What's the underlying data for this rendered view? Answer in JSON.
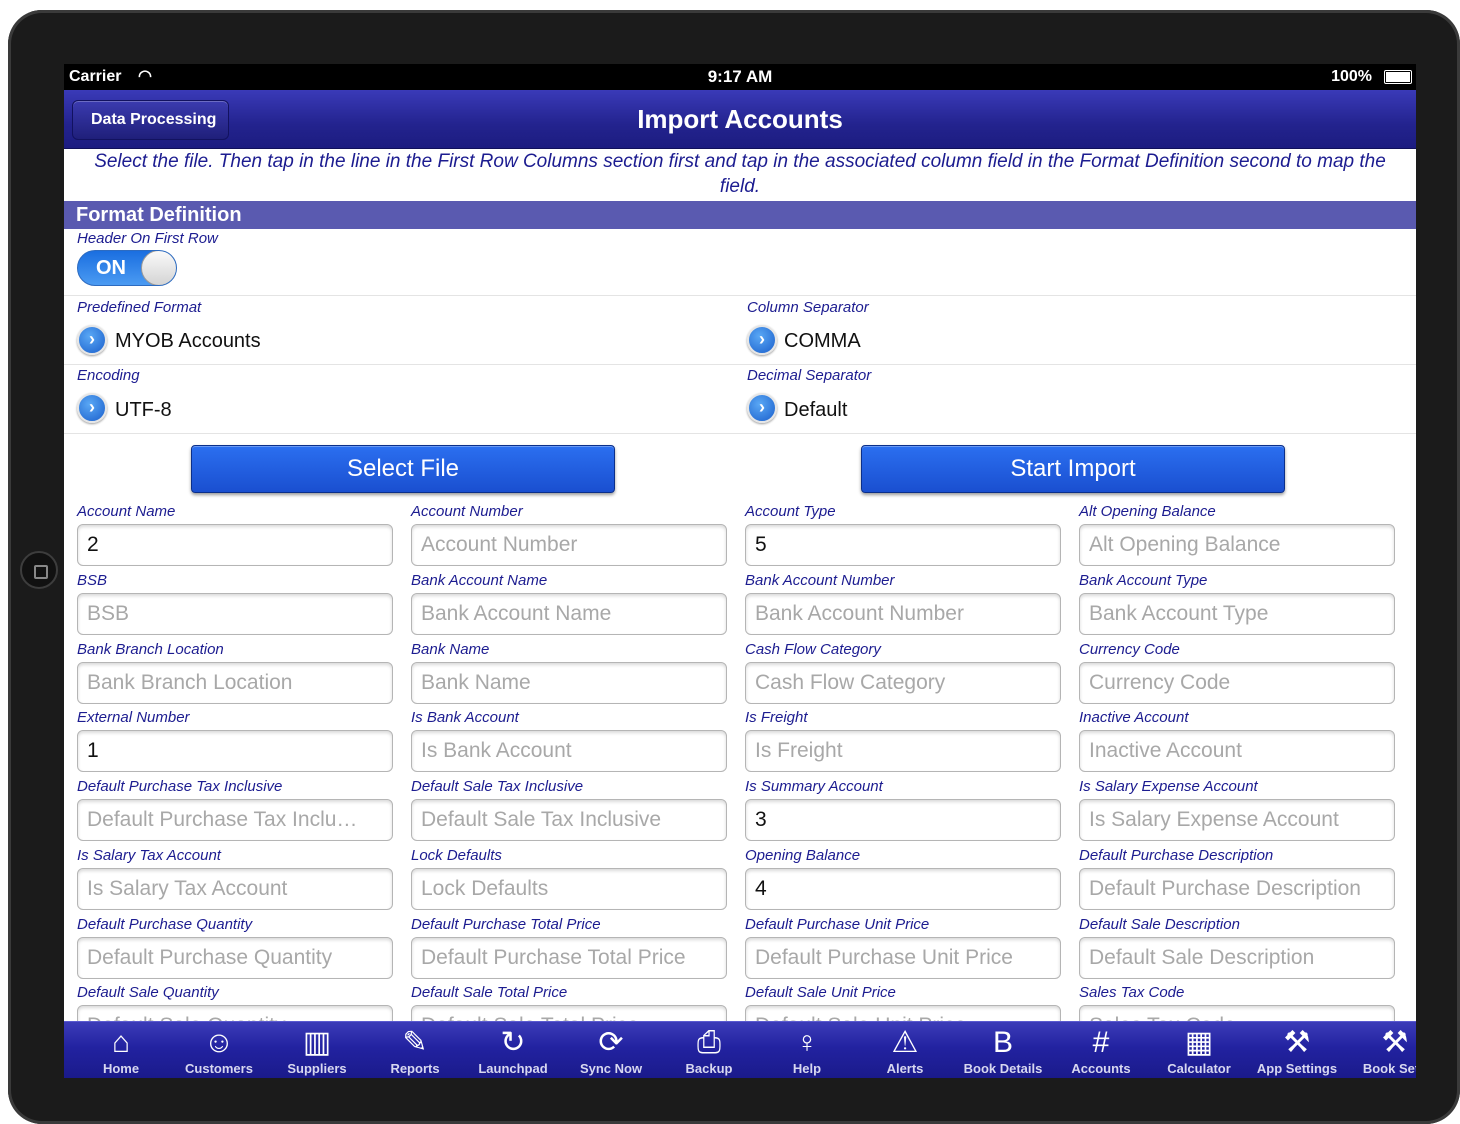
{
  "status": {
    "carrier": "Carrier",
    "time": "9:17 AM",
    "battery": "100%"
  },
  "nav": {
    "back_label": "Data Processing",
    "title": "Import Accounts"
  },
  "instructions": "Select the file. Then tap in the line in the First Row Columns section first and tap in the associated column field in the Format Definition second to map the field.",
  "section": {
    "title": "Format Definition"
  },
  "header_on_first_row": {
    "label": "Header On First Row",
    "toggle_text": "ON"
  },
  "predefined_format": {
    "label": "Predefined Format",
    "value": "MYOB Accounts"
  },
  "column_separator": {
    "label": "Column Separator",
    "value": "COMMA"
  },
  "encoding": {
    "label": "Encoding",
    "value": "UTF-8"
  },
  "decimal_separator": {
    "label": "Decimal Separator",
    "value": "Default"
  },
  "buttons": {
    "select_file": "Select File",
    "start_import": "Start Import"
  },
  "fields": [
    {
      "label": "Account Name",
      "value": "2",
      "placeholder": "Account Name"
    },
    {
      "label": "Account Number",
      "value": "",
      "placeholder": "Account Number"
    },
    {
      "label": "Account Type",
      "value": "5",
      "placeholder": "Account Type"
    },
    {
      "label": "Alt Opening Balance",
      "value": "",
      "placeholder": "Alt Opening Balance"
    },
    {
      "label": "BSB",
      "value": "",
      "placeholder": "BSB"
    },
    {
      "label": "Bank Account Name",
      "value": "",
      "placeholder": "Bank Account Name"
    },
    {
      "label": "Bank Account Number",
      "value": "",
      "placeholder": "Bank Account Number"
    },
    {
      "label": "Bank Account Type",
      "value": "",
      "placeholder": "Bank Account Type"
    },
    {
      "label": "Bank Branch Location",
      "value": "",
      "placeholder": "Bank Branch Location"
    },
    {
      "label": "Bank Name",
      "value": "",
      "placeholder": "Bank Name"
    },
    {
      "label": "Cash Flow Category",
      "value": "",
      "placeholder": "Cash Flow Category"
    },
    {
      "label": "Currency Code",
      "value": "",
      "placeholder": "Currency Code"
    },
    {
      "label": "External Number",
      "value": "1",
      "placeholder": "External Number"
    },
    {
      "label": "Is Bank Account",
      "value": "",
      "placeholder": "Is Bank Account"
    },
    {
      "label": "Is Freight",
      "value": "",
      "placeholder": "Is Freight"
    },
    {
      "label": "Inactive Account",
      "value": "",
      "placeholder": "Inactive Account"
    },
    {
      "label": "Default Purchase Tax Inclusive",
      "value": "",
      "placeholder": "Default Purchase Tax Inclu…"
    },
    {
      "label": "Default Sale Tax Inclusive",
      "value": "",
      "placeholder": "Default Sale Tax Inclusive"
    },
    {
      "label": "Is Summary Account",
      "value": "3",
      "placeholder": "Is Summary Account"
    },
    {
      "label": "Is Salary Expense Account",
      "value": "",
      "placeholder": "Is Salary Expense Account"
    },
    {
      "label": "Is Salary Tax Account",
      "value": "",
      "placeholder": "Is Salary Tax Account"
    },
    {
      "label": "Lock Defaults",
      "value": "",
      "placeholder": "Lock Defaults"
    },
    {
      "label": "Opening Balance",
      "value": "4",
      "placeholder": "Opening Balance"
    },
    {
      "label": "Default Purchase Description",
      "value": "",
      "placeholder": "Default Purchase Description"
    },
    {
      "label": "Default Purchase Quantity",
      "value": "",
      "placeholder": "Default Purchase Quantity"
    },
    {
      "label": "Default Purchase Total Price",
      "value": "",
      "placeholder": "Default Purchase Total Price"
    },
    {
      "label": "Default Purchase Unit Price",
      "value": "",
      "placeholder": "Default Purchase Unit Price"
    },
    {
      "label": "Default Sale Description",
      "value": "",
      "placeholder": "Default Sale Description"
    },
    {
      "label": "Default Sale Quantity",
      "value": "",
      "placeholder": "Default Sale Quantity"
    },
    {
      "label": "Default Sale Total Price",
      "value": "",
      "placeholder": "Default Sale Total Price"
    },
    {
      "label": "Default Sale Unit Price",
      "value": "",
      "placeholder": "Default Sale Unit Price"
    },
    {
      "label": "Sales Tax Code",
      "value": "",
      "placeholder": "Sales Tax Code"
    }
  ],
  "tabs": [
    {
      "label": "Home",
      "icon": "home-icon",
      "glyph": "⌂"
    },
    {
      "label": "Customers",
      "icon": "customers-icon",
      "glyph": "☺"
    },
    {
      "label": "Suppliers",
      "icon": "suppliers-icon",
      "glyph": "▥"
    },
    {
      "label": "Reports",
      "icon": "reports-icon",
      "glyph": "✎"
    },
    {
      "label": "Launchpad",
      "icon": "launchpad-icon",
      "glyph": "↻"
    },
    {
      "label": "Sync Now",
      "icon": "sync-icon",
      "glyph": "⟳"
    },
    {
      "label": "Backup",
      "icon": "backup-icon",
      "glyph": "⎙"
    },
    {
      "label": "Help",
      "icon": "help-icon",
      "glyph": "♀"
    },
    {
      "label": "Alerts",
      "icon": "alerts-icon",
      "glyph": "⚠"
    },
    {
      "label": "Book Details",
      "icon": "book-details-icon",
      "glyph": "B"
    },
    {
      "label": "Accounts",
      "icon": "accounts-icon",
      "glyph": "#"
    },
    {
      "label": "Calculator",
      "icon": "calculator-icon",
      "glyph": "▦"
    },
    {
      "label": "App Settings",
      "icon": "app-settings-icon",
      "glyph": "⚒"
    },
    {
      "label": "Book Setti",
      "icon": "book-settings-icon",
      "glyph": "⚒"
    }
  ]
}
